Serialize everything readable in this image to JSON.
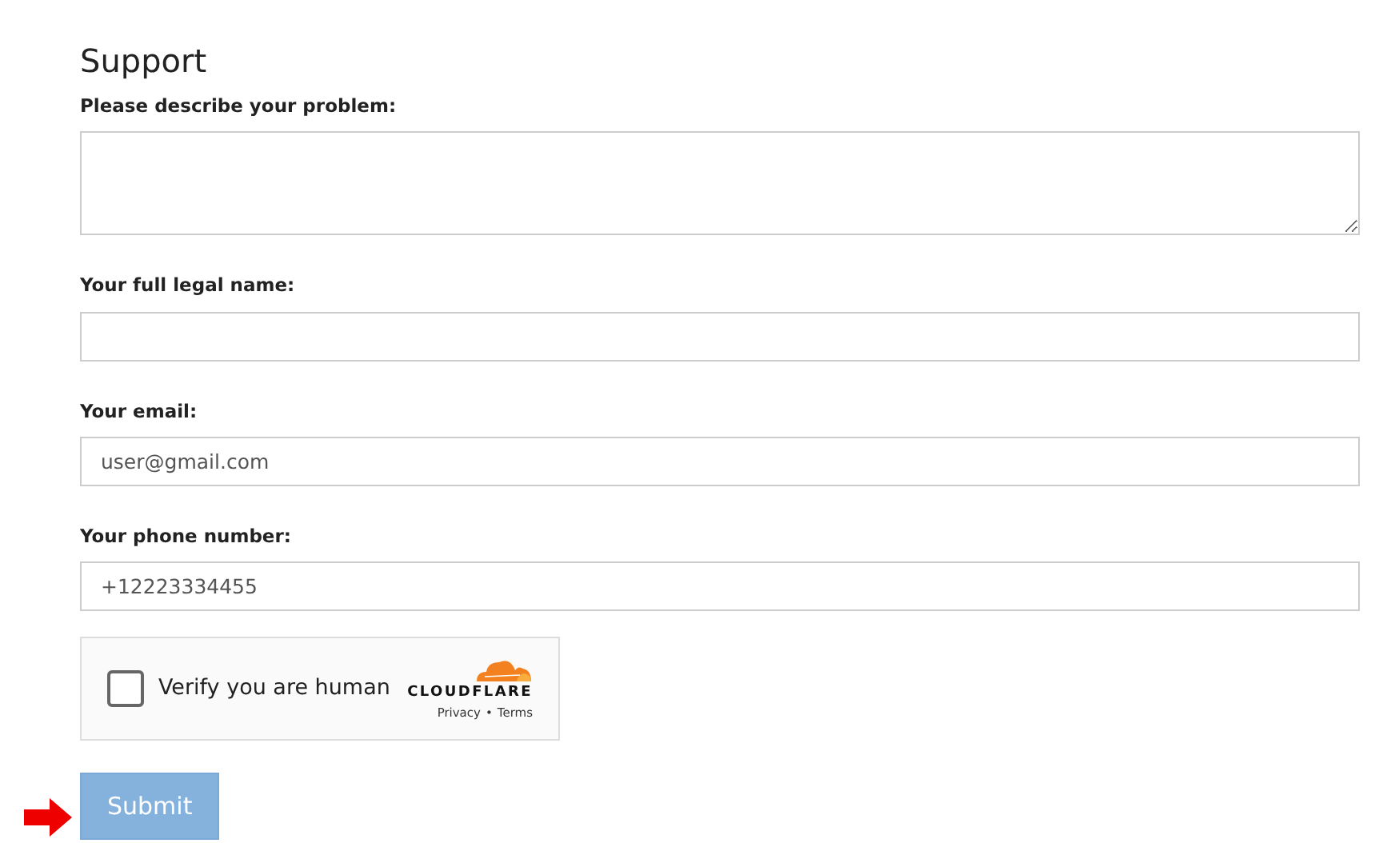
{
  "title": "Support",
  "fields": [
    {
      "label": "Please describe your problem:",
      "kind": "textarea"
    },
    {
      "label": "Your full legal name:",
      "kind": "input"
    },
    {
      "label": "Your email:",
      "kind": "input",
      "value": "user@gmail.com"
    },
    {
      "label": "Your phone number:",
      "kind": "input",
      "value": "+12223334455"
    }
  ],
  "captcha": {
    "label": "Verify you are human",
    "checked": false,
    "brand": "CLOUDFLARE",
    "links": [
      "Privacy",
      "•",
      "Terms"
    ]
  },
  "submit": {
    "label": "Submit",
    "disabled": true
  }
}
